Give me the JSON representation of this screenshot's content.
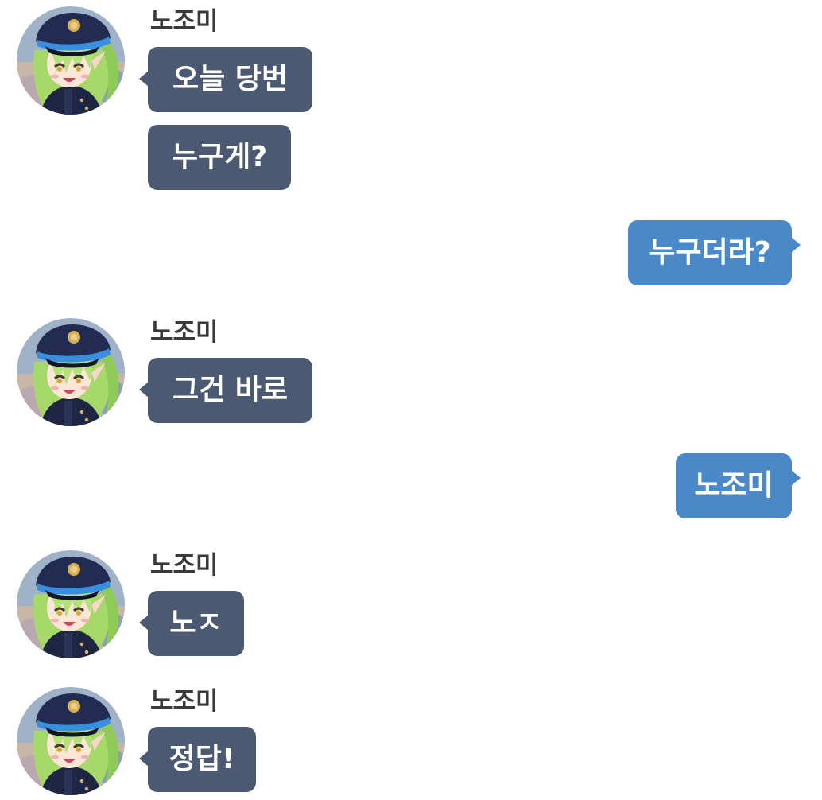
{
  "colors": {
    "received_bubble": "#4b5a72",
    "sent_bubble": "#4a88c8",
    "sender_name": "#3a3a3a",
    "background": "#ffffff"
  },
  "avatar_icon": "anime-character-avatar",
  "messages": [
    {
      "type": "received",
      "sender": "노조미",
      "text": "오늘 당번"
    },
    {
      "type": "received",
      "text": "누구게?"
    },
    {
      "type": "sent",
      "text": "누구더라?"
    },
    {
      "type": "received",
      "sender": "노조미",
      "text": "그건 바로"
    },
    {
      "type": "sent",
      "text": "노조미"
    },
    {
      "type": "received",
      "sender": "노조미",
      "text": "노ㅈ"
    },
    {
      "type": "received",
      "sender": "노조미",
      "text": "정답!"
    }
  ]
}
